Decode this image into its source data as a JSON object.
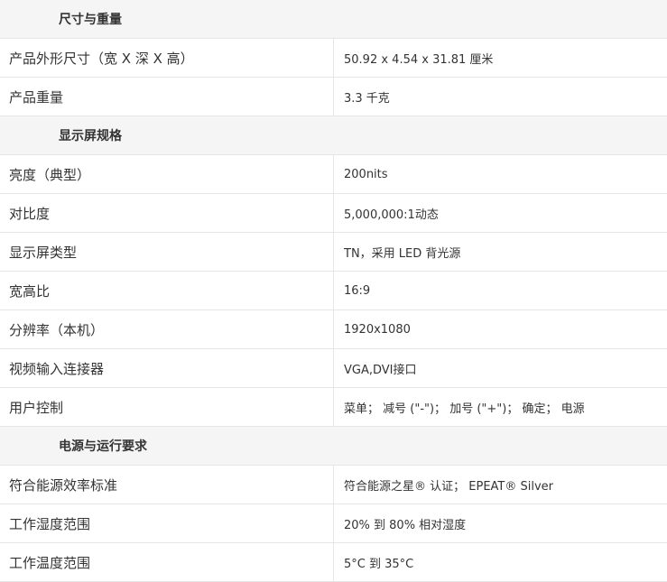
{
  "sections": [
    {
      "title": "尺寸与重量",
      "rows": [
        {
          "label": "产品外形尺寸（宽 X 深 X 高）",
          "value": "50.92 x 4.54 x 31.81 厘米"
        },
        {
          "label": "产品重量",
          "value": "3.3 千克"
        }
      ]
    },
    {
      "title": "显示屏规格",
      "rows": [
        {
          "label": "亮度（典型）",
          "value": "200nits"
        },
        {
          "label": "对比度",
          "value": "5,000,000:1动态"
        },
        {
          "label": "显示屏类型",
          "value": "TN，采用 LED 背光源"
        },
        {
          "label": "宽高比",
          "value": "16:9"
        },
        {
          "label": "分辨率（本机）",
          "value": "1920x1080"
        },
        {
          "label": "视频输入连接器",
          "value": "VGA,DVI接口"
        },
        {
          "label": "用户控制",
          "value": "菜单； 减号 (\"-\")； 加号 (\"+\")； 确定； 电源"
        }
      ]
    },
    {
      "title": "电源与运行要求",
      "rows": [
        {
          "label": "符合能源效率标准",
          "value": "符合能源之星® 认证； EPEAT® Silver"
        },
        {
          "label": "工作湿度范围",
          "value": "20% 到 80% 相对湿度"
        },
        {
          "label": "工作温度范围",
          "value": "5°C 到 35°C"
        }
      ]
    }
  ]
}
